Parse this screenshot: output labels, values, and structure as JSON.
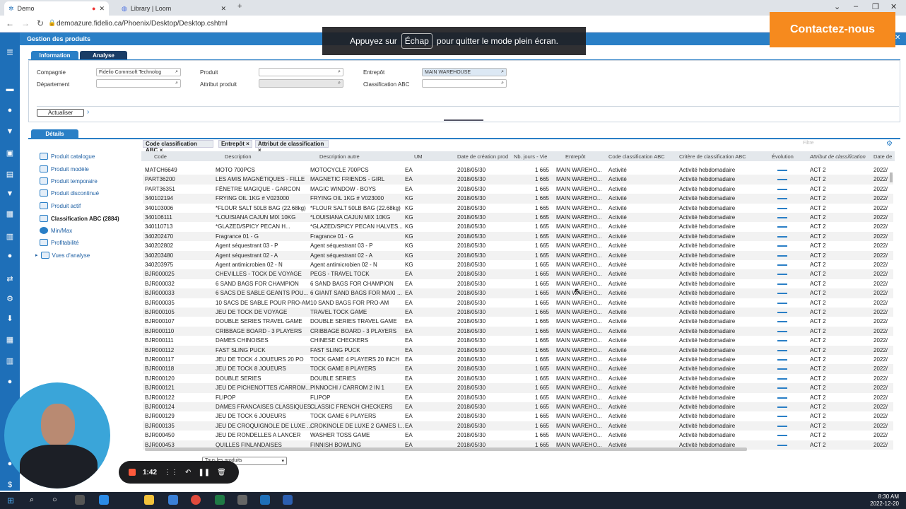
{
  "browser": {
    "tabs": [
      {
        "label": "Demo"
      },
      {
        "label": "Library | Loom"
      }
    ],
    "url": "demoazure.fidelio.ca/Phoenix/Desktop/Desktop.cshtml"
  },
  "fullscreen_notice": {
    "before": "Appuyez sur",
    "key": "Échap",
    "after": "pour quitter le mode plein écran."
  },
  "contact_button": "Contactez-nous",
  "app": {
    "title": "Gestion des produits",
    "tabs": [
      {
        "label": "Information"
      },
      {
        "label": "Analyse"
      }
    ],
    "filters": {
      "compagnie": {
        "label": "Compagnie",
        "value": "Fidelio Commsoft Technolog"
      },
      "departement": {
        "label": "Département",
        "value": ""
      },
      "produit": {
        "label": "Produit",
        "value": ""
      },
      "attribut": {
        "label": "Attribut produit",
        "value": ""
      },
      "entrepot": {
        "label": "Entrepôt",
        "value": "MAIN WAREHOUSE"
      },
      "classification": {
        "label": "Classification ABC",
        "value": ""
      }
    },
    "refresh_label": "Actualiser",
    "details_tab": "Détails",
    "sidebar": [
      {
        "label": "Produit catalogue"
      },
      {
        "label": "Produit modèle"
      },
      {
        "label": "Produit temporaire"
      },
      {
        "label": "Produit discontinué"
      },
      {
        "label": "Produit actif"
      },
      {
        "label": "Classification ABC (2884)"
      },
      {
        "label": "Min/Max"
      },
      {
        "label": "Profitabilité"
      },
      {
        "label": "Vues d'analyse"
      }
    ],
    "group_chips": [
      {
        "label": "Code classification ABC"
      },
      {
        "label": "Entrepôt"
      },
      {
        "label": "Attribut de classification"
      }
    ],
    "filter_placeholder": "Filtre",
    "page_select": "Tous les produits",
    "columns": [
      "Code",
      "Description",
      "Description autre",
      "UM",
      "Date de création prod",
      "Nb. jours - Vie",
      "Entrepôt",
      "Code classification ABC",
      "Critère de classification ABC",
      "Évolution",
      "Attribut de classification",
      "Date de"
    ],
    "rows": [
      [
        "MATCH6649",
        "MOTO 700PCS",
        "MOTOCYCLE 700PCS",
        "EA",
        "2018/05/30",
        "1 665",
        "MAIN WAREHO...",
        "Activité",
        "Activité hebdomadaire",
        "ACT 2",
        "2022/"
      ],
      [
        "PART36200",
        "LES AMIS MAGNÉTIQUES - FILLE",
        "MAGNETIC FRIENDS - GIRL",
        "EA",
        "2018/05/30",
        "1 665",
        "MAIN WAREHO...",
        "Activité",
        "Activité hebdomadaire",
        "ACT 2",
        "2022/"
      ],
      [
        "PART36351",
        "FÊNETRE MAGIQUE - GARCON",
        "MAGIC WINDOW - BOYS",
        "EA",
        "2018/05/30",
        "1 665",
        "MAIN WAREHO...",
        "Activité",
        "Activité hebdomadaire",
        "ACT 2",
        "2022/"
      ],
      [
        "340102194",
        "FRYING OIL 1KG # V023000",
        "FRYING OIL 1KG # V023000",
        "KG",
        "2018/05/30",
        "1 665",
        "MAIN WAREHO...",
        "Activité",
        "Activité hebdomadaire",
        "ACT 2",
        "2022/"
      ],
      [
        "340103006",
        "*FLOUR SALT 50LB BAG (22.68kg)",
        "*FLOUR SALT 50LB BAG (22.68kg)",
        "KG",
        "2018/05/30",
        "1 665",
        "MAIN WAREHO...",
        "Activité",
        "Activité hebdomadaire",
        "ACT 2",
        "2022/"
      ],
      [
        "340106111",
        "*LOUISIANA CAJUN MIX 10KG",
        "*LOUISIANA CAJUN MIX 10KG",
        "KG",
        "2018/05/30",
        "1 665",
        "MAIN WAREHO...",
        "Activité",
        "Activité hebdomadaire",
        "ACT 2",
        "2022/"
      ],
      [
        "340110713",
        "*GLAZED/SPICY PECAN H...",
        "*GLAZED/SPICY PECAN HALVES...",
        "KG",
        "2018/05/30",
        "1 665",
        "MAIN WAREHO...",
        "Activité",
        "Activité hebdomadaire",
        "ACT 2",
        "2022/"
      ],
      [
        "340202470",
        "Fragrance 01 - G",
        "Fragrance 01 - G",
        "KG",
        "2018/05/30",
        "1 665",
        "MAIN WAREHO...",
        "Activité",
        "Activité hebdomadaire",
        "ACT 2",
        "2022/"
      ],
      [
        "340202802",
        "Agent séquestrant 03 - P",
        "Agent séquestrant 03 - P",
        "KG",
        "2018/05/30",
        "1 665",
        "MAIN WAREHO...",
        "Activité",
        "Activité hebdomadaire",
        "ACT 2",
        "2022/"
      ],
      [
        "340203480",
        "Agent séquestrant 02 - A",
        "Agent séquestrant 02 - A",
        "KG",
        "2018/05/30",
        "1 665",
        "MAIN WAREHO...",
        "Activité",
        "Activité hebdomadaire",
        "ACT 2",
        "2022/"
      ],
      [
        "340203975",
        "Agent antimicrobien 02 - N",
        "Agent antimicrobien 02 - N",
        "KG",
        "2018/05/30",
        "1 665",
        "MAIN WAREHO...",
        "Activité",
        "Activité hebdomadaire",
        "ACT 2",
        "2022/"
      ],
      [
        "BJR000025",
        "CHEVILLES - TOCK DE VOYAGE",
        "PEGS - TRAVEL TOCK",
        "EA",
        "2018/05/30",
        "1 665",
        "MAIN WAREHO...",
        "Activité",
        "Activité hebdomadaire",
        "ACT 2",
        "2022/"
      ],
      [
        "BJR000032",
        "6 SAND BAGS FOR CHAMPION",
        "6 SAND BAGS FOR CHAMPION",
        "EA",
        "2018/05/30",
        "1 665",
        "MAIN WAREHO...",
        "Activité",
        "Activité hebdomadaire",
        "ACT 2",
        "2022/"
      ],
      [
        "BJR000033",
        "6 SACS DE SABLE GEANTS POU...",
        "6 GIANT SAND BAGS FOR MAXI ...",
        "EA",
        "2018/05/30",
        "1 665",
        "MAIN WAREHO...",
        "Activité",
        "Activité hebdomadaire",
        "ACT 2",
        "2022/"
      ],
      [
        "BJR000035",
        "10 SACS DE SABLE POUR PRO-AM",
        "10 SAND BAGS FOR PRO-AM",
        "EA",
        "2018/05/30",
        "1 665",
        "MAIN WAREHO...",
        "Activité",
        "Activité hebdomadaire",
        "ACT 2",
        "2022/"
      ],
      [
        "BJR000105",
        "JEU DE TOCK DE VOYAGE",
        "TRAVEL TOCK GAME",
        "EA",
        "2018/05/30",
        "1 665",
        "MAIN WAREHO...",
        "Activité",
        "Activité hebdomadaire",
        "ACT 2",
        "2022/"
      ],
      [
        "BJR000107",
        "DOUBLE SERIES TRAVEL GAME",
        "DOUBLE SERIES TRAVEL GAME",
        "EA",
        "2018/05/30",
        "1 665",
        "MAIN WAREHO...",
        "Activité",
        "Activité hebdomadaire",
        "ACT 2",
        "2022/"
      ],
      [
        "BJR000110",
        "CRIBBAGE BOARD - 3 PLAYERS",
        "CRIBBAGE BOARD - 3 PLAYERS",
        "EA",
        "2018/05/30",
        "1 665",
        "MAIN WAREHO...",
        "Activité",
        "Activité hebdomadaire",
        "ACT 2",
        "2022/"
      ],
      [
        "BJR000111",
        "DAMES CHINOISES",
        "CHINESE CHECKERS",
        "EA",
        "2018/05/30",
        "1 665",
        "MAIN WAREHO...",
        "Activité",
        "Activité hebdomadaire",
        "ACT 2",
        "2022/"
      ],
      [
        "BJR000112",
        "FAST SLING PUCK",
        "FAST SLING PUCK",
        "EA",
        "2018/05/30",
        "1 665",
        "MAIN WAREHO...",
        "Activité",
        "Activité hebdomadaire",
        "ACT 2",
        "2022/"
      ],
      [
        "BJR000117",
        "JEU DE TOCK 4 JOUEURS 20 PO",
        "TOCK GAME 4 PLAYERS 20 INCH",
        "EA",
        "2018/05/30",
        "1 665",
        "MAIN WAREHO...",
        "Activité",
        "Activité hebdomadaire",
        "ACT 2",
        "2022/"
      ],
      [
        "BJR000118",
        "JEU DE TOCK 8 JOUEURS",
        "TOCK GAME 8 PLAYERS",
        "EA",
        "2018/05/30",
        "1 665",
        "MAIN WAREHO...",
        "Activité",
        "Activité hebdomadaire",
        "ACT 2",
        "2022/"
      ],
      [
        "BJR000120",
        "DOUBLE SERIES",
        "DOUBLE SERIES",
        "EA",
        "2018/05/30",
        "1 665",
        "MAIN WAREHO...",
        "Activité",
        "Activité hebdomadaire",
        "ACT 2",
        "2022/"
      ],
      [
        "BJR000121",
        "JEU DE PICHENOTTES /CARROM...",
        "PINNOCHI / CARROM 2 IN 1",
        "EA",
        "2018/05/30",
        "1 665",
        "MAIN WAREHO...",
        "Activité",
        "Activité hebdomadaire",
        "ACT 2",
        "2022/"
      ],
      [
        "BJR000122",
        "FLIPOP",
        "FLIPOP",
        "EA",
        "2018/05/30",
        "1 665",
        "MAIN WAREHO...",
        "Activité",
        "Activité hebdomadaire",
        "ACT 2",
        "2022/"
      ],
      [
        "BJR000124",
        "DAMES FRANCAISES CLASSIQUES",
        "CLASSIC FRENCH CHECKERS",
        "EA",
        "2018/05/30",
        "1 665",
        "MAIN WAREHO...",
        "Activité",
        "Activité hebdomadaire",
        "ACT 2",
        "2022/"
      ],
      [
        "BJR000129",
        "JEU DE TOCK 6 JOUEURS",
        "TOCK GAME 6 PLAYERS",
        "EA",
        "2018/05/30",
        "1 665",
        "MAIN WAREHO...",
        "Activité",
        "Activité hebdomadaire",
        "ACT 2",
        "2022/"
      ],
      [
        "BJR000135",
        "JEU DE CROQUIGNOLE DE LUXE ...",
        "CROKINOLE DE LUXE 2 GAMES I...",
        "EA",
        "2018/05/30",
        "1 665",
        "MAIN WAREHO...",
        "Activité",
        "Activité hebdomadaire",
        "ACT 2",
        "2022/"
      ],
      [
        "BJR000450",
        "JEU DE RONDELLES A LANCER",
        "WASHER TOSS GAME",
        "EA",
        "2018/05/30",
        "1 665",
        "MAIN WAREHO...",
        "Activité",
        "Activité hebdomadaire",
        "ACT 2",
        "2022/"
      ],
      [
        "BJR000453",
        "QUILLES FINLANDAISES",
        "FINNISH BOWLING",
        "EA",
        "2018/05/30",
        "1 665",
        "MAIN WAREHO...",
        "Activité",
        "Activité hebdomadaire",
        "ACT 2",
        "2022/"
      ]
    ]
  },
  "recorder": {
    "time": "1:42"
  },
  "taskbar": {
    "time": "8:30 AM",
    "date": "2022-12-20"
  },
  "colors": {
    "brand": "#2a7fc6",
    "accent": "#f68a1e"
  }
}
